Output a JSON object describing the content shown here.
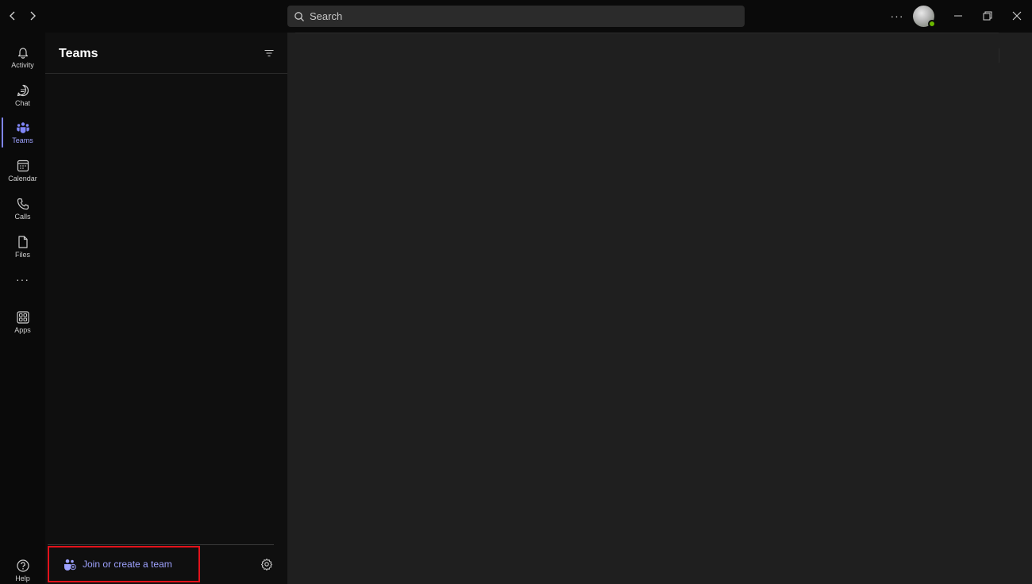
{
  "titlebar": {
    "search_placeholder": "Search",
    "more_label": "···",
    "presence_color": "#6bb700"
  },
  "rail": {
    "items": [
      {
        "label": "Activity",
        "icon": "bell-icon"
      },
      {
        "label": "Chat",
        "icon": "chat-icon"
      },
      {
        "label": "Teams",
        "icon": "teams-icon",
        "active": true
      },
      {
        "label": "Calendar",
        "icon": "calendar-icon"
      },
      {
        "label": "Calls",
        "icon": "phone-icon"
      },
      {
        "label": "Files",
        "icon": "file-icon"
      }
    ],
    "more_label": "···",
    "apps_label": "Apps",
    "help_label": "Help"
  },
  "panel": {
    "title": "Teams",
    "join_label": "Join or create a team"
  },
  "colors": {
    "accent": "#7f85f5",
    "accent_text": "#9ea2ff",
    "highlight_box": "#e3121b"
  }
}
